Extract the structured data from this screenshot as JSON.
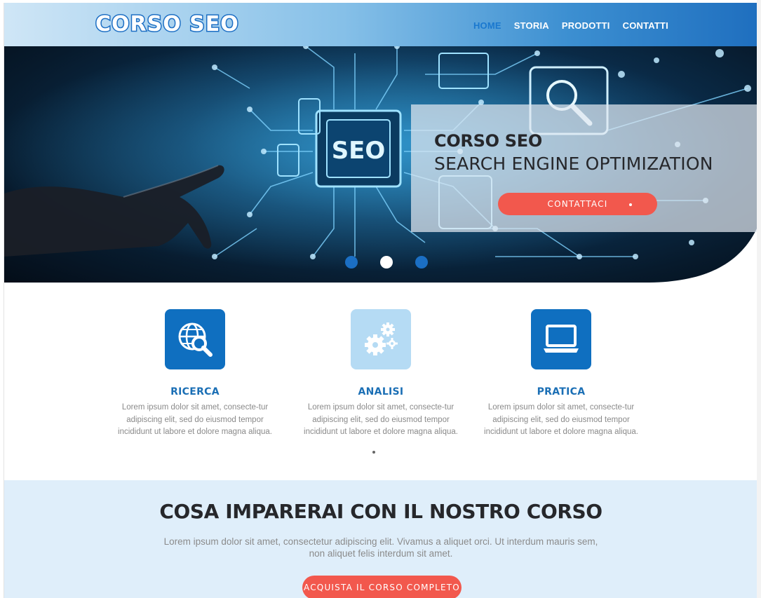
{
  "brand": {
    "logo": "CORSO SEO"
  },
  "nav": {
    "items": [
      "HOME",
      "STORIA",
      "PRODOTTI",
      "CONTATTI"
    ],
    "active": "HOME"
  },
  "hero": {
    "title": "CORSO SEO",
    "subtitle": "SEARCH ENGINE OPTIMIZATION",
    "cta_label": "CONTATTACI",
    "chip_text": "SEO",
    "slides": 3,
    "active_slide": 2
  },
  "features": [
    {
      "icon": "globe-search-icon",
      "title": "RICERCA",
      "text": "Lorem ipsum dolor sit amet, consecte-tur adipiscing elit, sed do eiusmod tempor incididunt ut labore et dolore magna aliqua."
    },
    {
      "icon": "gears-icon",
      "title": "ANALISI",
      "text": "Lorem ipsum dolor sit amet, consecte-tur adipiscing elit, sed do eiusmod tempor incididunt ut labore et dolore magna aliqua."
    },
    {
      "icon": "laptop-icon",
      "title": "PRATICA",
      "text": "Lorem ipsum dolor sit amet, consecte-tur adipiscing elit, sed do eiusmod tempor incididunt ut labore et dolore magna aliqua."
    }
  ],
  "learn": {
    "heading": "COSA IMPARERAI CON IL NOSTRO CORSO",
    "text": "Lorem ipsum dolor sit amet, consectetur adipiscing elit. Vivamus a aliquet orci. Ut interdum mauris sem, non aliquet felis interdum sit amet.",
    "button_label": "ACQUISTA IL CORSO COMPLETO"
  },
  "colors": {
    "primary": "#1b6fc4",
    "accent": "#f2584d",
    "section_bg": "#dfeefa",
    "text_dark": "#26272b"
  }
}
